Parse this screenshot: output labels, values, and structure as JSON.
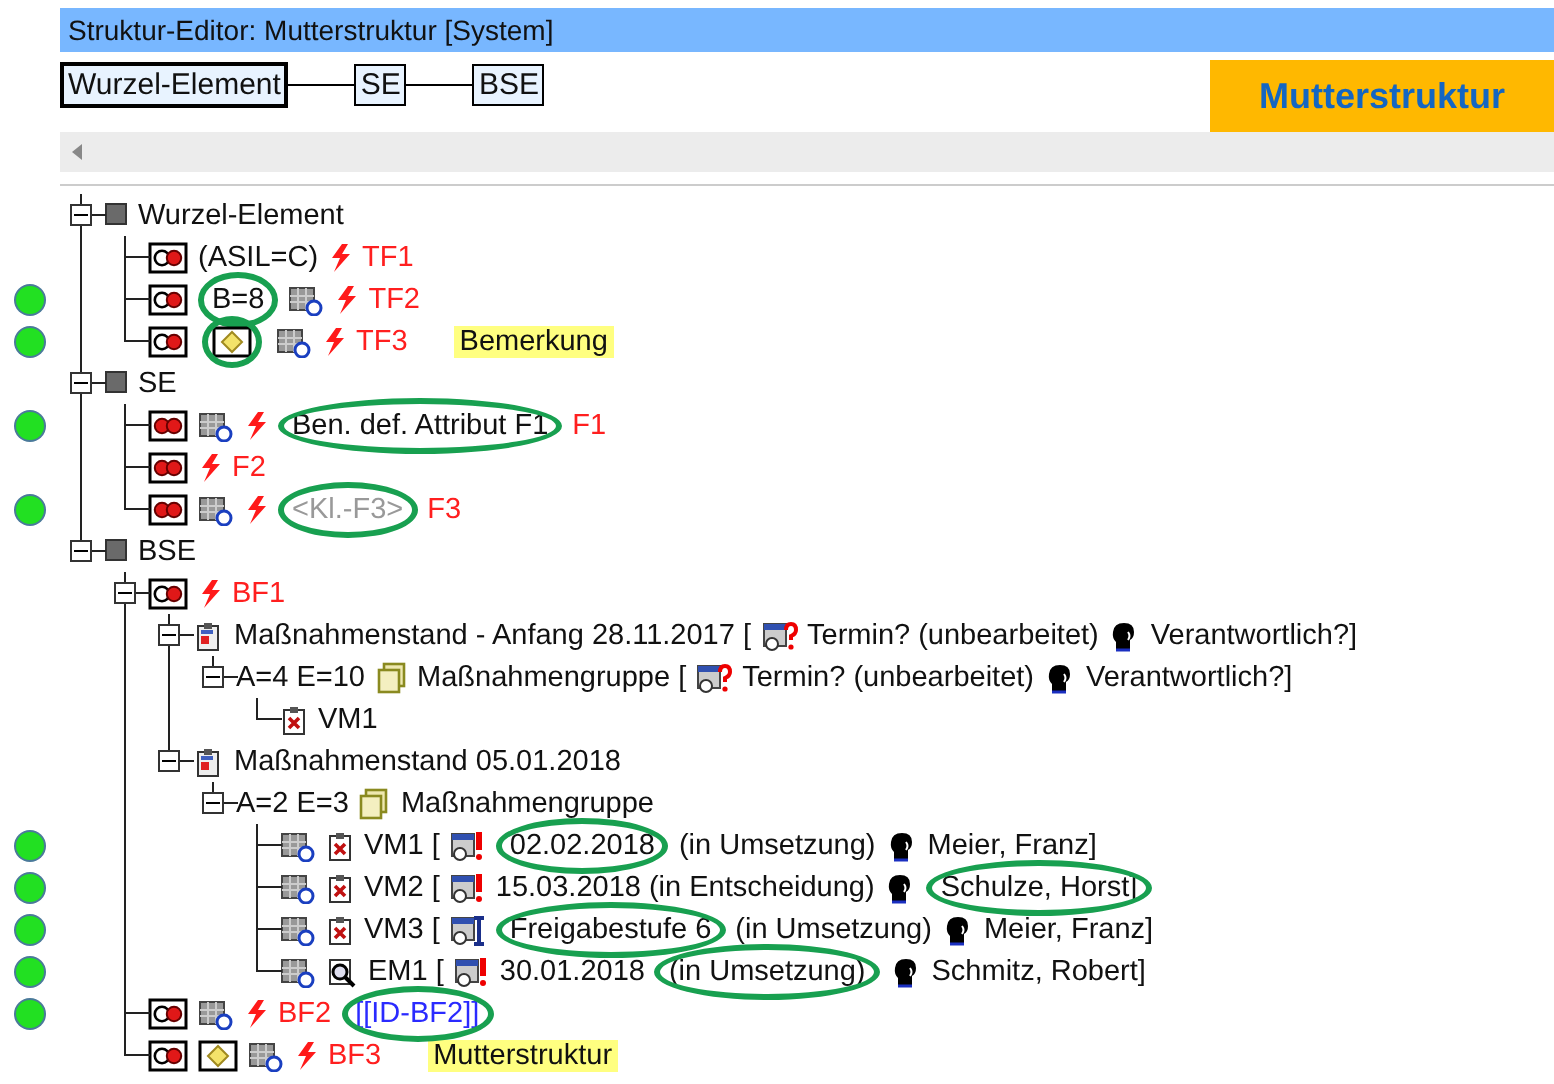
{
  "window": {
    "title": "Struktur-Editor: Mutterstruktur [System]"
  },
  "breadcrumb": [
    "Wurzel-Element",
    "SE",
    "BSE"
  ],
  "structure_label": "Mutterstruktur",
  "tree": [
    {
      "marked": false,
      "expanded": true,
      "segments": [
        {
          "kind": "square_icon"
        },
        {
          "kind": "text",
          "text": "Wurzel-Element"
        }
      ],
      "children": [
        {
          "marked": false,
          "segments": [
            {
              "kind": "half_circles_icon"
            },
            {
              "kind": "text",
              "text": "(ASIL=C)"
            },
            {
              "kind": "lightning_icon"
            },
            {
              "kind": "fault",
              "text": "TF1"
            }
          ]
        },
        {
          "marked": true,
          "segments": [
            {
              "kind": "half_circles_icon"
            },
            {
              "kind": "text",
              "text": "B=8",
              "circled": true
            },
            {
              "kind": "document_icon"
            },
            {
              "kind": "lightning_icon"
            },
            {
              "kind": "fault",
              "text": "TF2"
            }
          ]
        },
        {
          "marked": true,
          "segments": [
            {
              "kind": "half_circles_icon"
            },
            {
              "kind": "note_icon",
              "circled": true
            },
            {
              "kind": "document_icon"
            },
            {
              "kind": "lightning_icon"
            },
            {
              "kind": "fault",
              "text": "TF3"
            },
            {
              "kind": "note",
              "text": "Bemerkung"
            }
          ]
        }
      ]
    },
    {
      "marked": false,
      "expanded": true,
      "segments": [
        {
          "kind": "square_icon"
        },
        {
          "kind": "text",
          "text": "SE"
        }
      ],
      "children": [
        {
          "marked": true,
          "segments": [
            {
              "kind": "red_circles_icon"
            },
            {
              "kind": "document_icon"
            },
            {
              "kind": "lightning_icon"
            },
            {
              "kind": "text",
              "text": "Ben. def. Attribut F1",
              "circled": true
            },
            {
              "kind": "fault",
              "text": "F1"
            }
          ]
        },
        {
          "marked": false,
          "segments": [
            {
              "kind": "red_circles_icon"
            },
            {
              "kind": "lightning_icon"
            },
            {
              "kind": "fault",
              "text": "F2"
            }
          ]
        },
        {
          "marked": true,
          "segments": [
            {
              "kind": "red_circles_icon"
            },
            {
              "kind": "document_icon"
            },
            {
              "kind": "lightning_icon"
            },
            {
              "kind": "placeholder",
              "text": "<Kl.-F3>",
              "circled": true
            },
            {
              "kind": "fault",
              "text": "F3"
            }
          ]
        }
      ]
    },
    {
      "marked": false,
      "expanded": true,
      "segments": [
        {
          "kind": "square_icon"
        },
        {
          "kind": "text",
          "text": "BSE"
        }
      ],
      "children": [
        {
          "marked": false,
          "expanded": true,
          "segments": [
            {
              "kind": "half_circles_icon"
            },
            {
              "kind": "lightning_icon"
            },
            {
              "kind": "fault",
              "text": "BF1"
            }
          ],
          "children": [
            {
              "marked": false,
              "expanded": true,
              "segments": [
                {
                  "kind": "clipboard_icon"
                },
                {
                  "kind": "text",
                  "text": "Maßnahmenstand - Anfang 28.11.2017 ["
                },
                {
                  "kind": "calendar_question_icon"
                },
                {
                  "kind": "text",
                  "text": "Termin? (unbearbeitet)"
                },
                {
                  "kind": "person_icon"
                },
                {
                  "kind": "text",
                  "text": "Verantwortlich?]"
                }
              ],
              "children": [
                {
                  "marked": false,
                  "expanded": true,
                  "segments": [
                    {
                      "kind": "text",
                      "text": "A=4 E=10"
                    },
                    {
                      "kind": "pages_icon"
                    },
                    {
                      "kind": "text",
                      "text": "Maßnahmengruppe ["
                    },
                    {
                      "kind": "calendar_question_icon"
                    },
                    {
                      "kind": "text",
                      "text": "Termin? (unbearbeitet)"
                    },
                    {
                      "kind": "person_icon"
                    },
                    {
                      "kind": "text",
                      "text": "Verantwortlich?]"
                    }
                  ],
                  "children": [
                    {
                      "marked": false,
                      "segments": [
                        {
                          "kind": "clipboard_x_icon"
                        },
                        {
                          "kind": "text",
                          "text": "VM1"
                        }
                      ]
                    }
                  ]
                }
              ]
            },
            {
              "marked": false,
              "expanded": true,
              "segments": [
                {
                  "kind": "clipboard_icon"
                },
                {
                  "kind": "text",
                  "text": "Maßnahmenstand 05.01.2018"
                }
              ],
              "children": [
                {
                  "marked": false,
                  "expanded": true,
                  "segments": [
                    {
                      "kind": "text",
                      "text": "A=2 E=3"
                    },
                    {
                      "kind": "pages_icon"
                    },
                    {
                      "kind": "text",
                      "text": "Maßnahmengruppe"
                    }
                  ],
                  "children": [
                    {
                      "marked": true,
                      "segments": [
                        {
                          "kind": "document_icon"
                        },
                        {
                          "kind": "clipboard_x_icon"
                        },
                        {
                          "kind": "text",
                          "text": "VM1 ["
                        },
                        {
                          "kind": "calendar_alert_icon"
                        },
                        {
                          "kind": "text",
                          "text": "02.02.2018",
                          "circled": true
                        },
                        {
                          "kind": "text",
                          "text": "(in Umsetzung)"
                        },
                        {
                          "kind": "person_icon"
                        },
                        {
                          "kind": "text",
                          "text": "Meier, Franz]"
                        }
                      ]
                    },
                    {
                      "marked": true,
                      "segments": [
                        {
                          "kind": "document_icon"
                        },
                        {
                          "kind": "clipboard_x_icon"
                        },
                        {
                          "kind": "text",
                          "text": "VM2 ["
                        },
                        {
                          "kind": "calendar_alert_icon"
                        },
                        {
                          "kind": "text",
                          "text": "15.03.2018 (in Entscheidung)"
                        },
                        {
                          "kind": "person_icon"
                        },
                        {
                          "kind": "text",
                          "text": "Schulze, Horst]",
                          "circled": true
                        }
                      ]
                    },
                    {
                      "marked": true,
                      "segments": [
                        {
                          "kind": "document_icon"
                        },
                        {
                          "kind": "clipboard_x_icon"
                        },
                        {
                          "kind": "text",
                          "text": "VM3 ["
                        },
                        {
                          "kind": "calendar_key_icon"
                        },
                        {
                          "kind": "text",
                          "text": "Freigabestufe 6",
                          "circled": true
                        },
                        {
                          "kind": "text",
                          "text": "(in Umsetzung)"
                        },
                        {
                          "kind": "person_icon"
                        },
                        {
                          "kind": "text",
                          "text": "Meier, Franz]"
                        }
                      ]
                    },
                    {
                      "marked": true,
                      "segments": [
                        {
                          "kind": "document_icon"
                        },
                        {
                          "kind": "magnifier_icon"
                        },
                        {
                          "kind": "text",
                          "text": "EM1 ["
                        },
                        {
                          "kind": "calendar_alert_icon"
                        },
                        {
                          "kind": "text",
                          "text": "30.01.2018"
                        },
                        {
                          "kind": "text",
                          "text": "(in Umsetzung)",
                          "circled": true
                        },
                        {
                          "kind": "person_icon"
                        },
                        {
                          "kind": "text",
                          "text": "Schmitz, Robert]"
                        }
                      ]
                    }
                  ]
                }
              ]
            }
          ]
        },
        {
          "marked": true,
          "segments": [
            {
              "kind": "half_circles_icon"
            },
            {
              "kind": "document_icon"
            },
            {
              "kind": "lightning_icon"
            },
            {
              "kind": "fault",
              "text": "BF2"
            },
            {
              "kind": "link",
              "text": "[[ID-BF2]]",
              "circled": true
            }
          ]
        },
        {
          "marked": false,
          "segments": [
            {
              "kind": "half_circles_icon"
            },
            {
              "kind": "note_icon"
            },
            {
              "kind": "document_icon"
            },
            {
              "kind": "lightning_icon"
            },
            {
              "kind": "fault",
              "text": "BF3"
            },
            {
              "kind": "note",
              "text": "Mutterstruktur"
            }
          ]
        }
      ]
    }
  ]
}
